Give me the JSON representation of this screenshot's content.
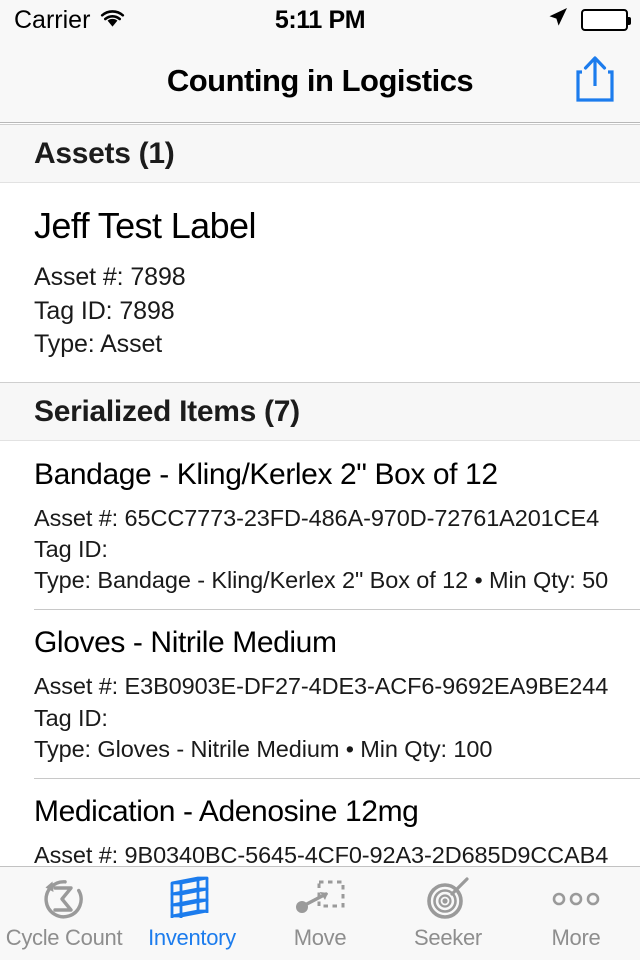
{
  "status_bar": {
    "carrier": "Carrier",
    "wifi_icon": "wifi-icon",
    "time": "5:11 PM",
    "location_icon": "location-arrow-icon",
    "battery_icon": "battery-full-icon",
    "battery_level": 100
  },
  "nav_bar": {
    "title": "Counting in Logistics",
    "share_icon": "share-icon",
    "accent_color": "#1c7ced"
  },
  "sections": [
    {
      "title": "Assets",
      "count": "(1)",
      "header_label": "Assets (1)",
      "style": "assets",
      "rows": [
        {
          "title": "Jeff Test Label",
          "lines": [
            "Asset #: 7898",
            "Tag ID: 7898",
            "Type: Asset"
          ]
        }
      ]
    },
    {
      "title": "Serialized Items",
      "count": "(7)",
      "header_label": "Serialized Items (7)",
      "style": "serialized",
      "rows": [
        {
          "title": "Bandage - Kling/Kerlex 2\" Box of 12",
          "lines": [
            "Asset #: 65CC7773-23FD-486A-970D-72761A201CE4",
            "Tag ID:",
            "Type: Bandage - Kling/Kerlex 2\" Box of 12 • Min Qty: 50"
          ]
        },
        {
          "title": "Gloves - Nitrile Medium",
          "lines": [
            "Asset #: E3B0903E-DF27-4DE3-ACF6-9692EA9BE244",
            "Tag ID:",
            "Type: Gloves - Nitrile Medium • Min Qty: 100"
          ]
        },
        {
          "title": "Medication - Adenosine 12mg",
          "lines": [
            "Asset #: 9B0340BC-5645-4CF0-92A3-2D685D9CCAB4"
          ]
        }
      ]
    }
  ],
  "tab_bar": {
    "active_color": "#1c7ced",
    "inactive_color": "#8e8e8e",
    "tabs": [
      {
        "label": "Cycle Count",
        "icon": "cycle-count-icon",
        "active": false
      },
      {
        "label": "Inventory",
        "icon": "inventory-shelf-icon",
        "active": true
      },
      {
        "label": "Move",
        "icon": "move-icon",
        "active": false
      },
      {
        "label": "Seeker",
        "icon": "seeker-target-icon",
        "active": false
      },
      {
        "label": "More",
        "icon": "more-ellipsis-icon",
        "active": false
      }
    ]
  }
}
